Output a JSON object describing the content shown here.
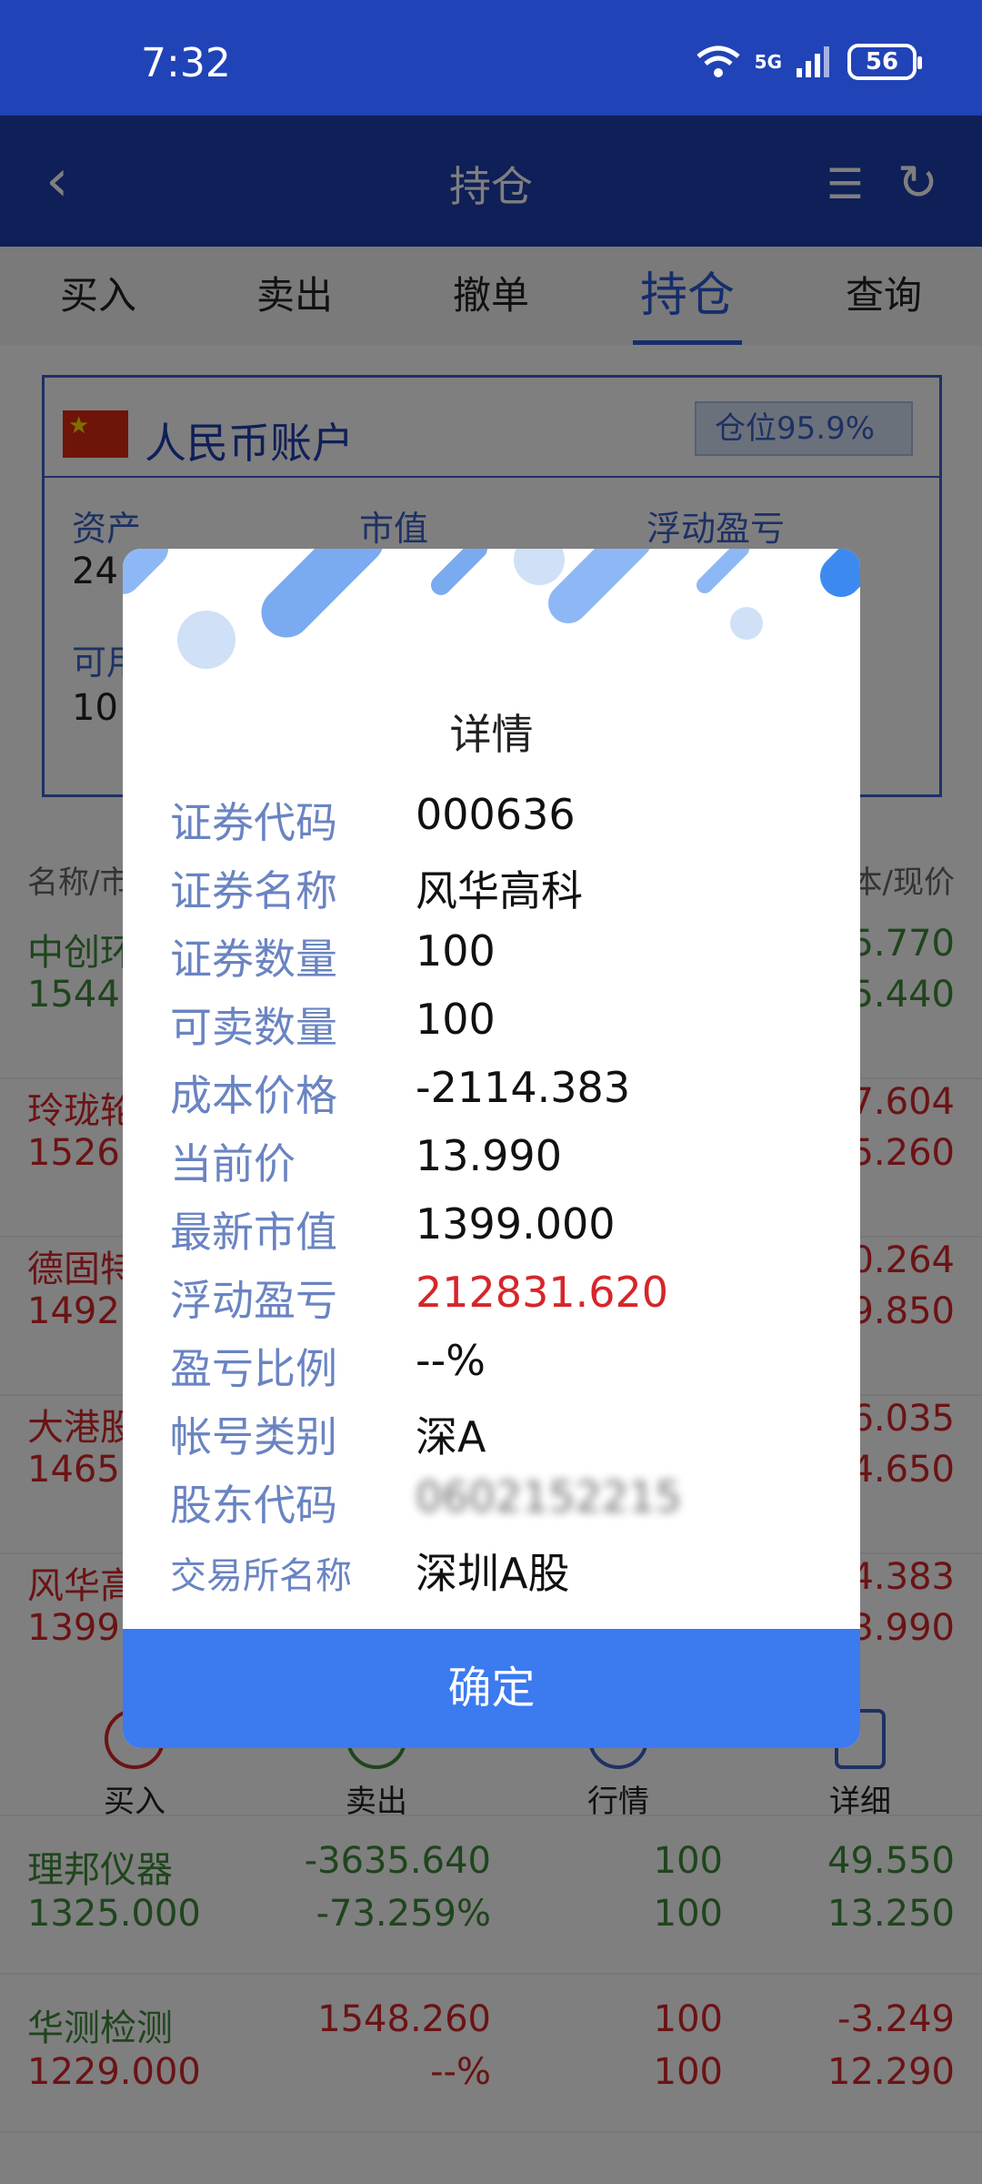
{
  "status_bar": {
    "time": "7:32",
    "network": "5G",
    "battery": "56"
  },
  "header": {
    "title": "持仓"
  },
  "tabs": [
    {
      "label": "买入"
    },
    {
      "label": "卖出"
    },
    {
      "label": "撤单"
    },
    {
      "label": "持仓"
    },
    {
      "label": "查询"
    }
  ],
  "account": {
    "name": "人民币账户",
    "position": "仓位95.9%",
    "labels": {
      "assets": "资产",
      "market_value": "市值",
      "floating_pl": "浮动盈亏",
      "available": "可用"
    },
    "assets_partial": "24",
    "available_partial": "10"
  },
  "list": {
    "header_left": "名称/市",
    "header_right": "本/现价",
    "rows": [
      {
        "name": "中创环",
        "sub": "1544.",
        "right1": "5.770",
        "right2": "5.440",
        "color": "green"
      },
      {
        "name": "玲珑轮",
        "sub": "1526.",
        "right1": "7.604",
        "right2": "5.260",
        "color": "red"
      },
      {
        "name": "德固特",
        "sub": "1492.",
        "right1": "0.264",
        "right2": "9.850",
        "color": "red"
      },
      {
        "name": "大港股",
        "sub": "1465.",
        "right1": "6.035",
        "right2": "4.650",
        "color": "red"
      },
      {
        "name": "风华高",
        "sub": "1399.",
        "right1": "4.383",
        "right2": "3.990",
        "color": "red"
      }
    ],
    "actions": [
      "买入",
      "卖出",
      "行情",
      "详细"
    ],
    "rows_bottom": [
      {
        "name": "理邦仪器",
        "market": "1325.000",
        "pl": "-3635.640",
        "pl_pct": "-73.259%",
        "qty1": "100",
        "qty2": "100",
        "cost": "49.550",
        "price": "13.250",
        "color": "green"
      },
      {
        "name": "华测检测",
        "market": "1229.000",
        "pl": "1548.260",
        "pl_pct": "--%",
        "qty1": "100",
        "qty2": "100",
        "cost": "-3.249",
        "price": "12.290",
        "color": "red"
      }
    ]
  },
  "dialog": {
    "title": "详情",
    "fields": [
      {
        "label": "证券代码",
        "value": "000636"
      },
      {
        "label": "证券名称",
        "value": "风华高科"
      },
      {
        "label": "证券数量",
        "value": "100"
      },
      {
        "label": "可卖数量",
        "value": "100"
      },
      {
        "label": "成本价格",
        "value": "-2114.383"
      },
      {
        "label": "当前价",
        "value": "13.990"
      },
      {
        "label": "最新市值",
        "value": "1399.000"
      },
      {
        "label": "浮动盈亏",
        "value": "212831.620"
      },
      {
        "label": "盈亏比例",
        "value": "--%"
      },
      {
        "label": "帐号类别",
        "value": "深A"
      },
      {
        "label": "股东代码",
        "value": "0602152215"
      },
      {
        "label": "交易所名称",
        "value": "深圳A股"
      }
    ],
    "confirm_label": "确定"
  },
  "colors": {
    "primary": "#1f3fae",
    "accent": "#3c7af0",
    "gain": "#d6262a",
    "loss": "#3e8a3a",
    "label": "#6a84c2"
  }
}
